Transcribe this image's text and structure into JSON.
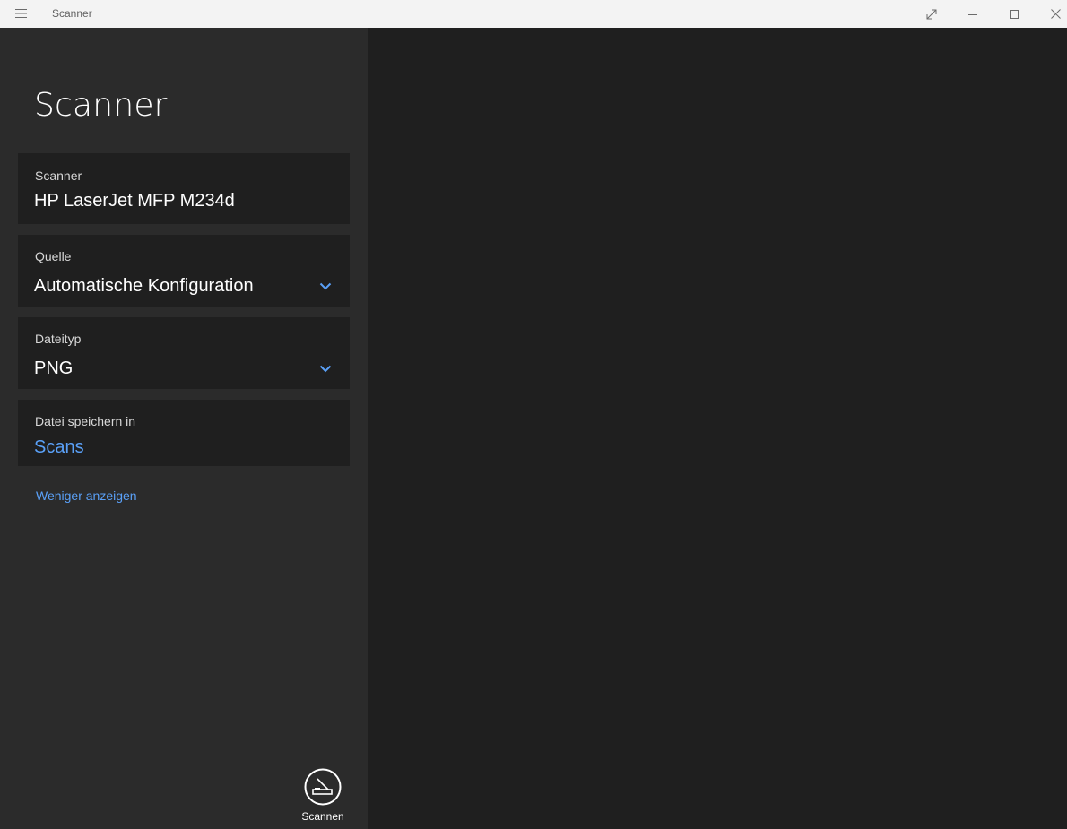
{
  "titlebar": {
    "title": "Scanner",
    "icons": [
      "hamburger-menu-icon",
      "expand-icon",
      "minimize-icon",
      "maximize-icon",
      "close-icon"
    ]
  },
  "sidebar": {
    "page_title": "Scanner",
    "fields": {
      "scanner": {
        "label": "Scanner",
        "value": "HP LaserJet MFP M234d"
      },
      "source": {
        "label": "Quelle",
        "value": "Automatische Konfiguration"
      },
      "filetype": {
        "label": "Dateityp",
        "value": "PNG"
      },
      "save_to": {
        "label": "Datei speichern in",
        "value": "Scans"
      }
    },
    "show_less": "Weniger anzeigen",
    "scan_button": {
      "label": "Scannen",
      "icon": "scanner-icon"
    }
  },
  "colors": {
    "accent": "#5aa0f7",
    "sidebar_bg": "#2b2b2b",
    "field_bg": "#1f1f1f",
    "preview_bg": "#1f1f1f",
    "titlebar_bg": "#f3f3f3"
  }
}
